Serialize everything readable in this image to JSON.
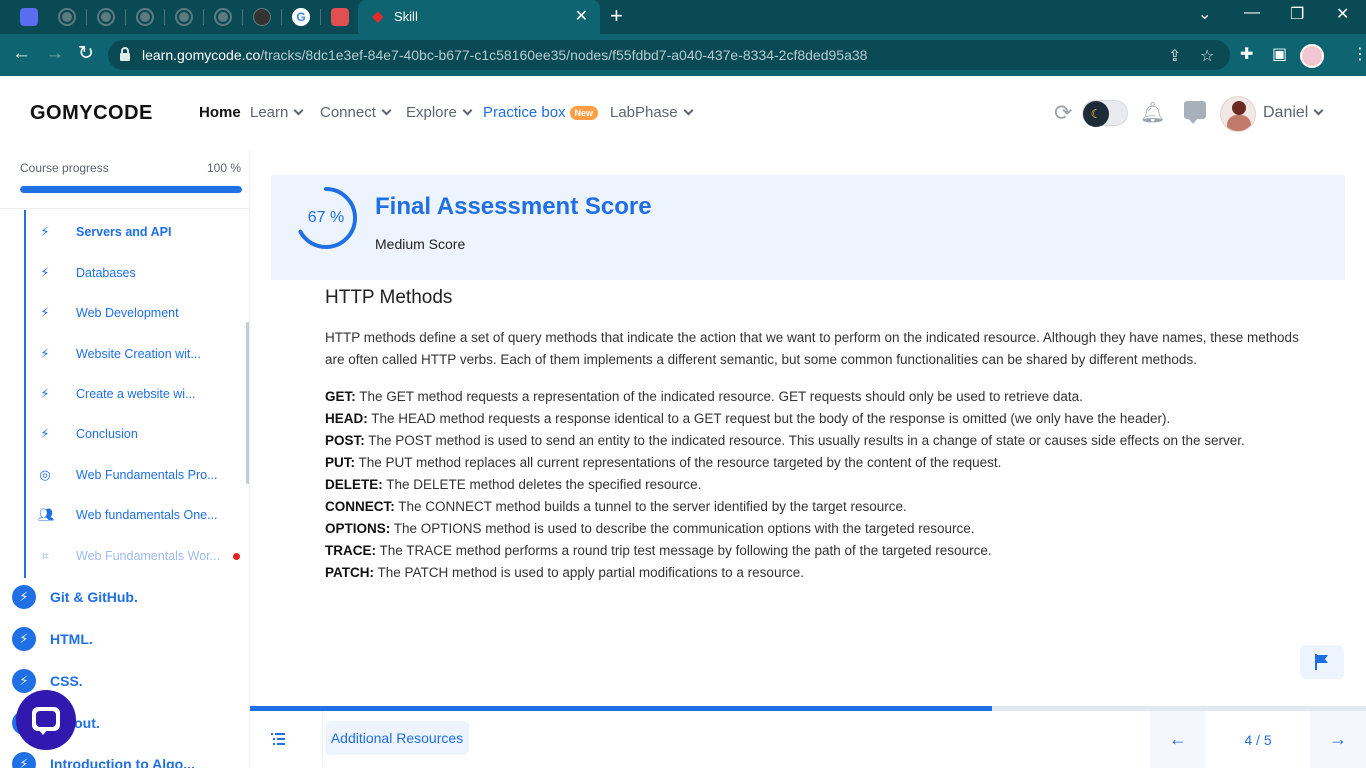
{
  "browser": {
    "active_tab_title": "Skill",
    "url_host": "learn.gomycode.co",
    "url_path": "/tracks/8dc1e3ef-84e7-40bc-b677-c1c58160ee35/nodes/f55fdbd7-a040-437e-8334-2cf8ded95a38",
    "new_tab_glyph": "+",
    "close_glyph": "✕"
  },
  "header": {
    "logo": "GOMYCODE",
    "nav": {
      "home": "Home",
      "learn": "Learn",
      "connect": "Connect",
      "explore": "Explore",
      "practice": "Practice box",
      "practice_badge": "New",
      "labphase": "LabPhase"
    },
    "user_name": "Daniel"
  },
  "sidebar": {
    "progress_label": "Course progress",
    "progress_value": "100 %",
    "progress_fraction": 1.0,
    "sub_items": [
      {
        "label": "Servers and API",
        "icon": "bolt-icon"
      },
      {
        "label": "Databases",
        "icon": "bolt-icon"
      },
      {
        "label": "Web Development",
        "icon": "bolt-icon"
      },
      {
        "label": "Website Creation wit...",
        "icon": "bolt-icon"
      },
      {
        "label": "Create a website wi...",
        "icon": "bolt-icon"
      },
      {
        "label": "Conclusion",
        "icon": "bolt-icon"
      },
      {
        "label": "Web Fundamentals Pro...",
        "icon": "target-icon"
      },
      {
        "label": "Web fundamentals One...",
        "icon": "people-icon"
      },
      {
        "label": "Web Fundamentals Wor...",
        "icon": "workshop-icon"
      }
    ],
    "modules": [
      {
        "label": "Git & GitHub."
      },
      {
        "label": "HTML."
      },
      {
        "label": "CSS."
      },
      {
        "label": "Layout."
      },
      {
        "label": "Introduction to Algo..."
      }
    ]
  },
  "score": {
    "percent_label": "67 %",
    "percent_value": 67,
    "title": "Final Assessment Score",
    "subtitle": "Medium Score"
  },
  "article": {
    "title": "HTTP Methods",
    "intro": "HTTP methods define a set of query methods that indicate the action that we want to perform on the indicated resource. Although they have names, these methods are often called HTTP verbs. Each of them implements a different semantic, but some common functionalities can be shared by different methods.",
    "methods": [
      {
        "name": "GET:",
        "desc": " The GET method requests a representation of the indicated resource. GET requests should only be used to retrieve data."
      },
      {
        "name": "HEAD:",
        "desc": " The HEAD method requests a response identical to a GET request but the body of the response is omitted (we only have the header)."
      },
      {
        "name": "POST:",
        "desc": " The POST method is used to send an entity to the indicated resource. This usually results in a change of state or causes side effects on the server."
      },
      {
        "name": "PUT:",
        "desc": " The PUT method replaces all current representations of the resource targeted by the content of the request."
      },
      {
        "name": "DELETE:",
        "desc": " The DELETE method deletes the specified resource."
      },
      {
        "name": "CONNECT:",
        "desc": " The CONNECT method builds a tunnel to the server identified by the target resource."
      },
      {
        "name": "OPTIONS:",
        "desc": " The OPTIONS method is used to describe the communication options with the targeted resource."
      },
      {
        "name": "TRACE:",
        "desc": " The TRACE method performs a round trip test message by following the path of the targeted resource."
      },
      {
        "name": "PATCH:",
        "desc": " The PATCH method is used to apply partial modifications to a resource."
      }
    ]
  },
  "bottom": {
    "additional_resources": "Additional Resources",
    "pager": "4 / 5",
    "progress_fraction": 0.665
  },
  "colors": {
    "accent": "#1f6fe5",
    "browser_dark": "#0a4a55",
    "browser_mid": "#0e6470",
    "card_bg": "#eef4fe",
    "chat_fab": "#3119b0"
  }
}
